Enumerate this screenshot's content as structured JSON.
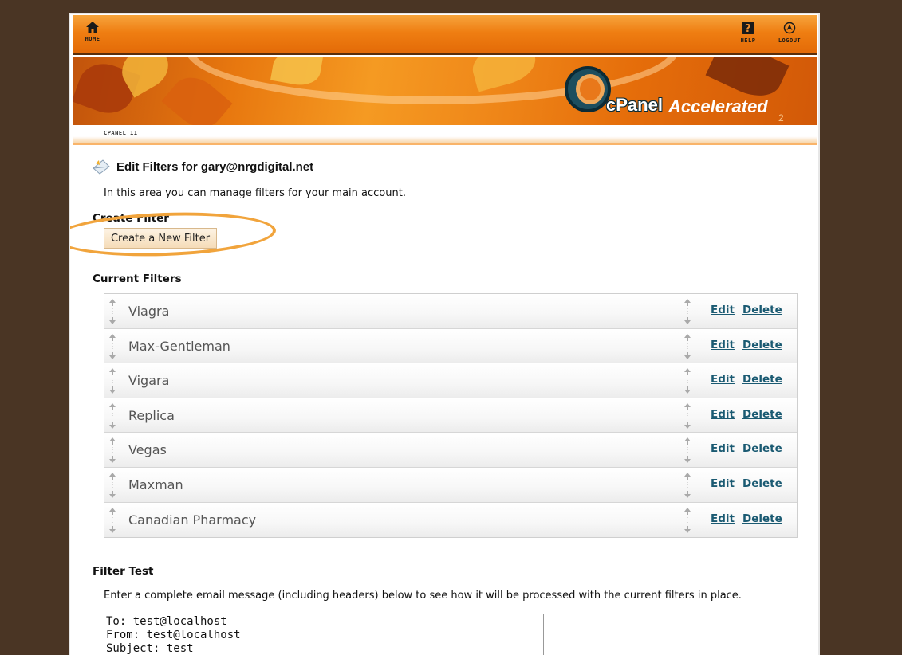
{
  "nav": {
    "home_label": "HOME",
    "help_label": "HELP",
    "logout_label": "LOGOUT"
  },
  "banner": {
    "logo_text": "cPanel",
    "logo_sub": "Accelerated",
    "logo_version": "2"
  },
  "version_label": "CPANEL 11",
  "page": {
    "title": "Edit Filters for gary@nrgdigital.net",
    "intro": "In this area you can manage filters for your main account."
  },
  "create": {
    "heading": "Create Filter",
    "button_label": "Create a New Filter"
  },
  "current": {
    "heading": "Current Filters",
    "edit_label": "Edit",
    "delete_label": "Delete",
    "filters": [
      {
        "name": "Viagra"
      },
      {
        "name": "Max-Gentleman"
      },
      {
        "name": "Vigara"
      },
      {
        "name": "Replica"
      },
      {
        "name": "Vegas"
      },
      {
        "name": "Maxman"
      },
      {
        "name": "Canadian Pharmacy"
      }
    ]
  },
  "test": {
    "heading": "Filter Test",
    "description": "Enter a complete email message (including headers) below to see how it will be processed with the current filters in place.",
    "message": "To: test@localhost\nFrom: test@localhost\nSubject: test"
  },
  "colors": {
    "background": "#4a3524",
    "accent_orange": "#ef7e12",
    "link": "#1a5a72",
    "highlight_circle": "#f1a43c"
  }
}
